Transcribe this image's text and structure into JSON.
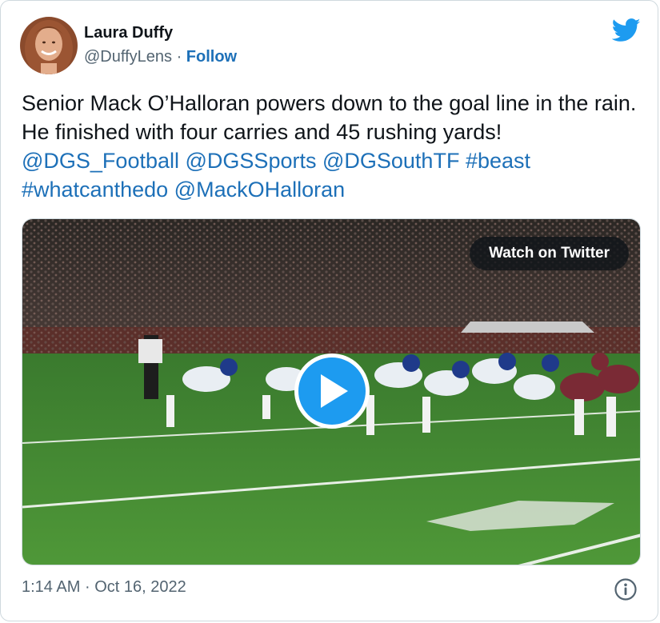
{
  "author": {
    "name": "Laura Duffy",
    "handle": "@DuffyLens",
    "separator": "·",
    "follow_label": "Follow",
    "avatar_icon": "profile-photo"
  },
  "brand": {
    "icon": "twitter-bird-icon",
    "color": "#1d9bf0"
  },
  "tweet": {
    "text_plain": "Senior Mack O’Halloran powers down to the goal line in the rain. He finished with four carries and 45 rushing yards!",
    "mentions": [
      "@DGS_Football",
      "@DGSSports",
      "@DGSouthTF"
    ],
    "hashtag_1": "#beast",
    "hashtag_2": "#whatcanthedo",
    "mention_4": "@MackOHalloran",
    "link_color": "#1d70b8"
  },
  "media": {
    "watch_label": "Watch on Twitter",
    "play_icon": "play-icon"
  },
  "footer": {
    "time": "1:14 AM",
    "separator": "·",
    "date": "Oct 16, 2022",
    "info_icon": "info-icon"
  }
}
